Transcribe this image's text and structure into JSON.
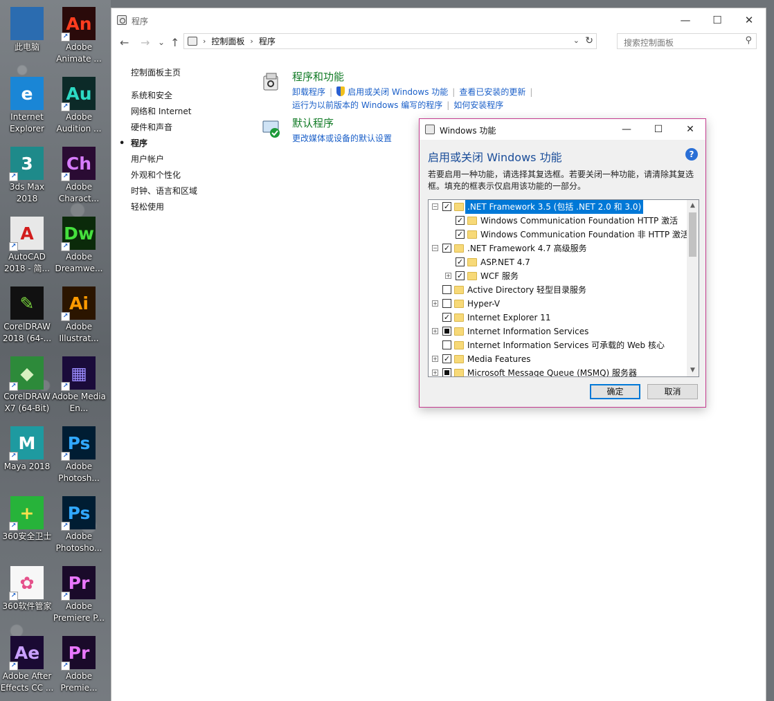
{
  "desktop": {
    "icons": [
      {
        "label": "此电脑",
        "glyph": "",
        "bg": "#2b6cb0",
        "fg": "#fff",
        "shortcut": false
      },
      {
        "label": "Adobe Animate ...",
        "glyph": "An",
        "bg": "#2a0a0a",
        "fg": "#ff3d1f",
        "shortcut": true
      },
      {
        "label": "Internet Explorer",
        "glyph": "e",
        "bg": "#1a86d6",
        "fg": "#fff",
        "shortcut": false
      },
      {
        "label": "Adobe Audition ...",
        "glyph": "Au",
        "bg": "#0c2a28",
        "fg": "#2dd9c3",
        "shortcut": true
      },
      {
        "label": "3ds Max 2018",
        "glyph": "3",
        "bg": "#1e8a8a",
        "fg": "#fff",
        "shortcut": true
      },
      {
        "label": "Adobe Charact...",
        "glyph": "Ch",
        "bg": "#2a0b33",
        "fg": "#d77cff",
        "shortcut": true
      },
      {
        "label": "AutoCAD 2018 - 简...",
        "glyph": "A",
        "bg": "#e8e8e8",
        "fg": "#d21c1c",
        "shortcut": true
      },
      {
        "label": "Adobe Dreamwe...",
        "glyph": "Dw",
        "bg": "#0b2a0a",
        "fg": "#45e03d",
        "shortcut": true
      },
      {
        "label": "CorelDRAW 2018 (64-...",
        "glyph": "✎",
        "bg": "#111",
        "fg": "#7bd63f",
        "shortcut": false
      },
      {
        "label": "Adobe Illustrat...",
        "glyph": "Ai",
        "bg": "#2b1500",
        "fg": "#ff9a00",
        "shortcut": true
      },
      {
        "label": "CorelDRAW X7 (64-Bit)",
        "glyph": "◆",
        "bg": "#2d8a3a",
        "fg": "#d8f0c0",
        "shortcut": true
      },
      {
        "label": "Adobe Media En...",
        "glyph": "▦",
        "bg": "#1a0b3a",
        "fg": "#9b8cff",
        "shortcut": true
      },
      {
        "label": "Maya 2018",
        "glyph": "M",
        "bg": "#1e9aa0",
        "fg": "#fff",
        "shortcut": true
      },
      {
        "label": "Adobe Photosh...",
        "glyph": "Ps",
        "bg": "#001d33",
        "fg": "#31a8ff",
        "shortcut": true
      },
      {
        "label": "360安全卫士",
        "glyph": "+",
        "bg": "#27b33a",
        "fg": "#ffe14d",
        "shortcut": true
      },
      {
        "label": "Adobe Photosho...",
        "glyph": "Ps",
        "bg": "#001d33",
        "fg": "#31a8ff",
        "shortcut": true
      },
      {
        "label": "360软件管家",
        "glyph": "✿",
        "bg": "#f7f7f7",
        "fg": "#e5508a",
        "shortcut": true
      },
      {
        "label": "Adobe Premiere P...",
        "glyph": "Pr",
        "bg": "#1a0a2a",
        "fg": "#ea77ff",
        "shortcut": true
      },
      {
        "label": "Adobe After Effects CC ...",
        "glyph": "Ae",
        "bg": "#1a0a33",
        "fg": "#c9a0ff",
        "shortcut": true
      },
      {
        "label": "Adobe Premie...",
        "glyph": "Pr",
        "bg": "#1a0a2a",
        "fg": "#ea77ff",
        "shortcut": true
      }
    ]
  },
  "explorer": {
    "title": "程序",
    "nav": {
      "back": "←",
      "forward": "→",
      "recent": "⌄",
      "up": "↑"
    },
    "breadcrumb": [
      "控制面板",
      "程序"
    ],
    "search_placeholder": "搜索控制面板",
    "left_nav": [
      {
        "label": "控制面板主页",
        "current": false
      },
      {
        "label": "系统和安全",
        "current": false
      },
      {
        "label": "网络和 Internet",
        "current": false
      },
      {
        "label": "硬件和声音",
        "current": false
      },
      {
        "label": "程序",
        "current": true
      },
      {
        "label": "用户帐户",
        "current": false
      },
      {
        "label": "外观和个性化",
        "current": false
      },
      {
        "label": "时钟、语言和区域",
        "current": false
      },
      {
        "label": "轻松使用",
        "current": false
      }
    ],
    "sections": {
      "programs": {
        "heading": "程序和功能",
        "links": [
          "卸载程序",
          "启用或关闭 Windows 功能",
          "查看已安装的更新",
          "运行为以前版本的 Windows 编写的程序",
          "如何安装程序"
        ]
      },
      "defaults": {
        "heading": "默认程序",
        "links": [
          "更改媒体或设备的默认设置"
        ]
      }
    }
  },
  "dialog": {
    "title": "Windows 功能",
    "heading": "启用或关闭 Windows 功能",
    "description": "若要启用一种功能，请选择其复选框。若要关闭一种功能，请清除其复选框。填充的框表示仅启用该功能的一部分。",
    "features": [
      {
        "label": ".NET Framework 3.5 (包括 .NET 2.0 和 3.0)",
        "level": 0,
        "expander": "−",
        "state": "checked",
        "selected": true
      },
      {
        "label": "Windows Communication Foundation HTTP 激活",
        "level": 1,
        "expander": "",
        "state": "checked",
        "selected": false
      },
      {
        "label": "Windows Communication Foundation 非 HTTP 激活",
        "level": 1,
        "expander": "",
        "state": "checked",
        "selected": false
      },
      {
        "label": ".NET Framework 4.7 高级服务",
        "level": 0,
        "expander": "−",
        "state": "checked",
        "selected": false
      },
      {
        "label": "ASP.NET 4.7",
        "level": 1,
        "expander": "",
        "state": "checked",
        "selected": false
      },
      {
        "label": "WCF 服务",
        "level": 1,
        "expander": "+",
        "state": "checked",
        "selected": false
      },
      {
        "label": "Active Directory 轻型目录服务",
        "level": 0,
        "expander": "",
        "state": "unchecked",
        "selected": false
      },
      {
        "label": "Hyper-V",
        "level": 0,
        "expander": "+",
        "state": "unchecked",
        "selected": false
      },
      {
        "label": "Internet Explorer 11",
        "level": 0,
        "expander": "",
        "state": "checked",
        "selected": false
      },
      {
        "label": "Internet Information Services",
        "level": 0,
        "expander": "+",
        "state": "partial",
        "selected": false
      },
      {
        "label": "Internet Information Services 可承载的 Web 核心",
        "level": 0,
        "expander": "",
        "state": "unchecked",
        "selected": false
      },
      {
        "label": "Media Features",
        "level": 0,
        "expander": "+",
        "state": "checked",
        "selected": false
      },
      {
        "label": "Microsoft Message Queue (MSMQ) 服务器",
        "level": 0,
        "expander": "+",
        "state": "partial",
        "selected": false
      }
    ],
    "ok_label": "确定",
    "cancel_label": "取消"
  },
  "colors": {
    "link": "#1a5fc8",
    "heading_green": "#107a25",
    "dialog_heading": "#1a4d99",
    "selection": "#0078d7",
    "dialog_border": "#c43a8e"
  }
}
